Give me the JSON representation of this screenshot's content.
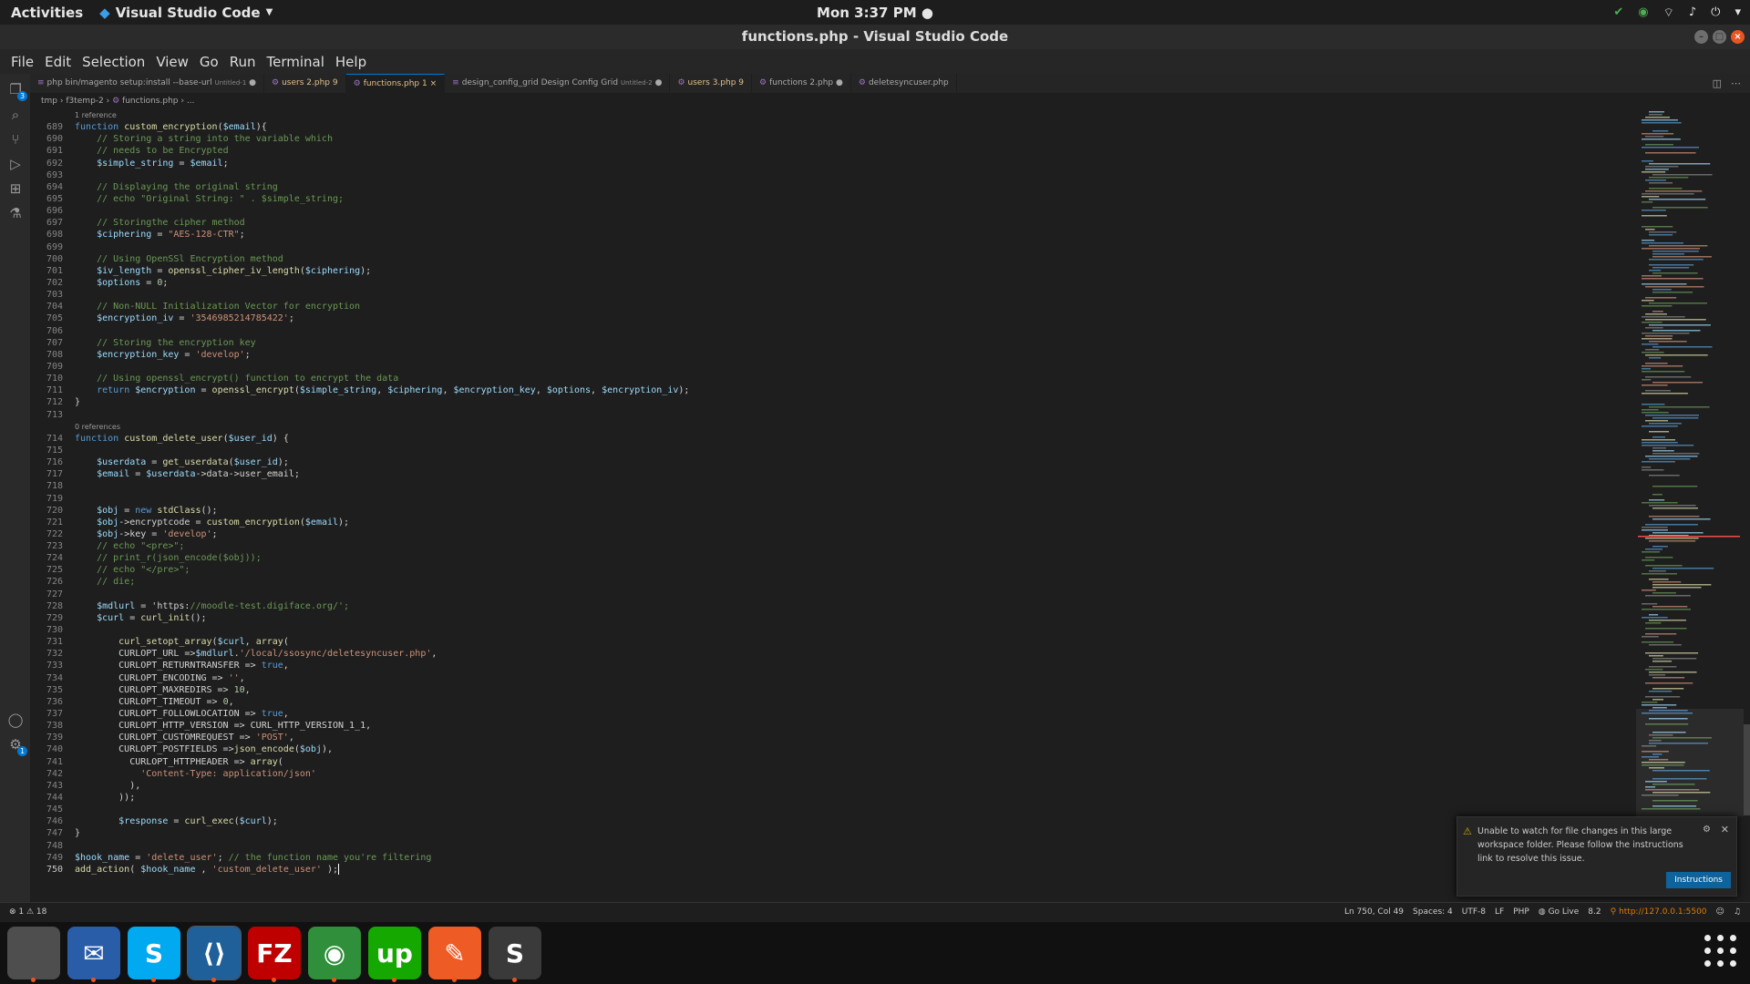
{
  "topbar": {
    "activities": "Activities",
    "app_name": "Visual Studio Code",
    "clock": "Mon  3:37 PM"
  },
  "window": {
    "title": "functions.php - Visual Studio Code"
  },
  "menu": [
    "File",
    "Edit",
    "Selection",
    "View",
    "Go",
    "Run",
    "Terminal",
    "Help"
  ],
  "activity_bar": {
    "explorer_badge": "3",
    "settings_badge": "1"
  },
  "tabs": [
    {
      "label": "php bin/magento setup:install --base-url",
      "sub": "Untitled-1",
      "suffix": "●"
    },
    {
      "label": "users 2.php",
      "sub": "",
      "suffix": "9"
    },
    {
      "label": "functions.php",
      "sub": "",
      "suffix": "1 ×"
    },
    {
      "label": "design_config_grid Design Config Grid",
      "sub": "Untitled-2",
      "suffix": "●"
    },
    {
      "label": "users 3.php",
      "sub": "",
      "suffix": "9"
    },
    {
      "label": "functions 2.php",
      "sub": "",
      "suffix": "●"
    },
    {
      "label": "deletesyncuser.php",
      "sub": "",
      "suffix": ""
    }
  ],
  "breadcrumb": [
    "tmp",
    "f3temp-2",
    "functions.php",
    "..."
  ],
  "code_lines": [
    {
      "n": "",
      "t": "1 reference",
      "lens": true
    },
    {
      "n": "689",
      "t": "function custom_encryption($email){"
    },
    {
      "n": "690",
      "t": "    // Storing a string into the variable which"
    },
    {
      "n": "691",
      "t": "    // needs to be Encrypted"
    },
    {
      "n": "692",
      "t": "    $simple_string = $email;"
    },
    {
      "n": "693",
      "t": ""
    },
    {
      "n": "694",
      "t": "    // Displaying the original string"
    },
    {
      "n": "695",
      "t": "    // echo \"Original String: \" . $simple_string;"
    },
    {
      "n": "696",
      "t": ""
    },
    {
      "n": "697",
      "t": "    // Storingthe cipher method"
    },
    {
      "n": "698",
      "t": "    $ciphering = \"AES-128-CTR\";"
    },
    {
      "n": "699",
      "t": ""
    },
    {
      "n": "700",
      "t": "    // Using OpenSSl Encryption method"
    },
    {
      "n": "701",
      "t": "    $iv_length = openssl_cipher_iv_length($ciphering);"
    },
    {
      "n": "702",
      "t": "    $options = 0;"
    },
    {
      "n": "703",
      "t": ""
    },
    {
      "n": "704",
      "t": "    // Non-NULL Initialization Vector for encryption"
    },
    {
      "n": "705",
      "t": "    $encryption_iv = '3546985214785422';"
    },
    {
      "n": "706",
      "t": ""
    },
    {
      "n": "707",
      "t": "    // Storing the encryption key"
    },
    {
      "n": "708",
      "t": "    $encryption_key = 'develop';"
    },
    {
      "n": "709",
      "t": ""
    },
    {
      "n": "710",
      "t": "    // Using openssl_encrypt() function to encrypt the data"
    },
    {
      "n": "711",
      "t": "    return $encryption = openssl_encrypt($simple_string, $ciphering, $encryption_key, $options, $encryption_iv);"
    },
    {
      "n": "712",
      "t": "}"
    },
    {
      "n": "713",
      "t": ""
    },
    {
      "n": "",
      "t": "0 references",
      "lens": true
    },
    {
      "n": "714",
      "t": "function custom_delete_user($user_id) {"
    },
    {
      "n": "715",
      "t": ""
    },
    {
      "n": "716",
      "t": "    $userdata = get_userdata($user_id);"
    },
    {
      "n": "717",
      "t": "    $email = $userdata->data->user_email;"
    },
    {
      "n": "718",
      "t": ""
    },
    {
      "n": "719",
      "t": ""
    },
    {
      "n": "720",
      "t": "    $obj = new stdClass();"
    },
    {
      "n": "721",
      "t": "    $obj->encryptcode = custom_encryption($email);"
    },
    {
      "n": "722",
      "t": "    $obj->key = 'develop';"
    },
    {
      "n": "723",
      "t": "    // echo \"<pre>\";"
    },
    {
      "n": "724",
      "t": "    // print_r(json_encode($obj));"
    },
    {
      "n": "725",
      "t": "    // echo \"</pre>\";"
    },
    {
      "n": "726",
      "t": "    // die;"
    },
    {
      "n": "727",
      "t": ""
    },
    {
      "n": "728",
      "t": "    $mdlurl = 'https://moodle-test.digiface.org/';"
    },
    {
      "n": "729",
      "t": "    $curl = curl_init();"
    },
    {
      "n": "730",
      "t": ""
    },
    {
      "n": "731",
      "t": "        curl_setopt_array($curl, array("
    },
    {
      "n": "732",
      "t": "        CURLOPT_URL =>$mdlurl.'/local/ssosync/deletesyncuser.php',"
    },
    {
      "n": "733",
      "t": "        CURLOPT_RETURNTRANSFER => true,"
    },
    {
      "n": "734",
      "t": "        CURLOPT_ENCODING => '',"
    },
    {
      "n": "735",
      "t": "        CURLOPT_MAXREDIRS => 10,"
    },
    {
      "n": "736",
      "t": "        CURLOPT_TIMEOUT => 0,"
    },
    {
      "n": "737",
      "t": "        CURLOPT_FOLLOWLOCATION => true,"
    },
    {
      "n": "738",
      "t": "        CURLOPT_HTTP_VERSION => CURL_HTTP_VERSION_1_1,"
    },
    {
      "n": "739",
      "t": "        CURLOPT_CUSTOMREQUEST => 'POST',"
    },
    {
      "n": "740",
      "t": "        CURLOPT_POSTFIELDS =>json_encode($obj),"
    },
    {
      "n": "741",
      "t": "          CURLOPT_HTTPHEADER => array("
    },
    {
      "n": "742",
      "t": "            'Content-Type: application/json'"
    },
    {
      "n": "743",
      "t": "          ),"
    },
    {
      "n": "744",
      "t": "        ));"
    },
    {
      "n": "745",
      "t": ""
    },
    {
      "n": "746",
      "t": "        $response = curl_exec($curl);"
    },
    {
      "n": "747",
      "t": "}"
    },
    {
      "n": "748",
      "t": ""
    },
    {
      "n": "749",
      "t": "$hook_name = 'delete_user'; // the function name you're filtering"
    },
    {
      "n": "750",
      "t": "add_action( $hook_name , 'custom_delete_user' );",
      "cur": true
    }
  ],
  "notification": {
    "message": "Unable to watch for file changes in this large workspace folder. Please follow the instructions link to resolve this issue.",
    "button": "Instructions"
  },
  "status": {
    "problems": "⊗ 1 ⚠ 18",
    "position": "Ln 750, Col 49",
    "spaces": "Spaces: 4",
    "encoding": "UTF-8",
    "eol": "LF",
    "language": "PHP",
    "golive": "◍ Go Live",
    "php_version": "8.2",
    "server": "⚲ http://127.0.0.1:5500"
  },
  "colors": {
    "keyword": "#569cd6",
    "string": "#ce9178",
    "comment": "#6a9955",
    "variable": "#9cdcfe",
    "function": "#dcdcaa",
    "number": "#b5cea8",
    "accent": "#007acc"
  },
  "dock": [
    {
      "name": "files",
      "label": "",
      "bg": "#4e4e4e"
    },
    {
      "name": "thunderbird",
      "label": "✉",
      "bg": "#2a5da8"
    },
    {
      "name": "skype",
      "label": "S",
      "bg": "#00a9f0"
    },
    {
      "name": "vscode",
      "label": "⟨⟩",
      "bg": "#1f5f9a"
    },
    {
      "name": "filezilla",
      "label": "FZ",
      "bg": "#bf0000"
    },
    {
      "name": "chrome",
      "label": "◉",
      "bg": "#2f8f3b"
    },
    {
      "name": "upwork",
      "label": "up",
      "bg": "#14a800"
    },
    {
      "name": "postman",
      "label": "✎",
      "bg": "#ef5b25"
    },
    {
      "name": "sublime",
      "label": "S",
      "bg": "#3a3a3a"
    }
  ]
}
